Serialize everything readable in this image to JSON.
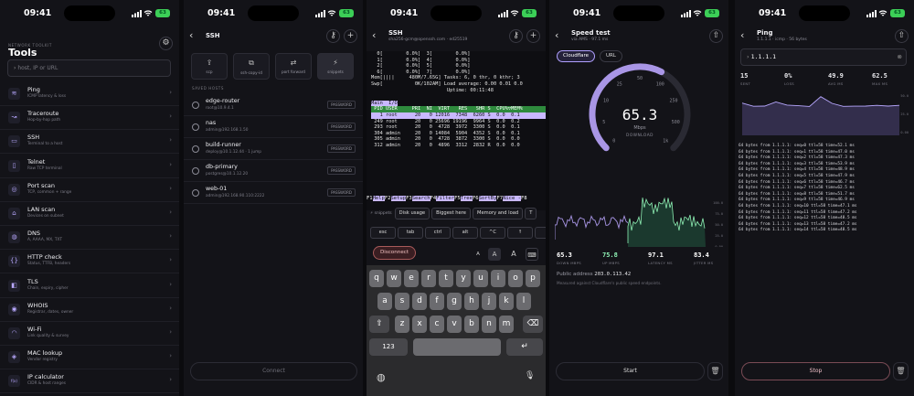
{
  "status": {
    "time": "09:41",
    "battery": "63"
  },
  "p1": {
    "kicker": "NETWORK TOOLKIT",
    "title": "Tools",
    "search_placeholder": "host, IP or URL",
    "tools": [
      {
        "name": "Ping",
        "desc": "ICMP latency & loss",
        "icon": "ping-icon",
        "glyph": "≋"
      },
      {
        "name": "Traceroute",
        "desc": "Hop-by-hop path",
        "icon": "route-icon",
        "glyph": "↝"
      },
      {
        "name": "SSH",
        "desc": "Terminal to a host",
        "icon": "terminal-icon",
        "glyph": "▭"
      },
      {
        "name": "Telnet",
        "desc": "Raw TCP terminal",
        "icon": "telnet-icon",
        "glyph": "▯"
      },
      {
        "name": "Port scan",
        "desc": "TCP, common + range",
        "icon": "port-icon",
        "glyph": "◎"
      },
      {
        "name": "LAN scan",
        "desc": "Devices on subnet",
        "icon": "lan-icon",
        "glyph": "⌂"
      },
      {
        "name": "DNS",
        "desc": "A, AAAA, MX, TXT",
        "icon": "globe-icon",
        "glyph": "◍"
      },
      {
        "name": "HTTP check",
        "desc": "Status, TTFB, headers",
        "icon": "braces-icon",
        "glyph": "{}"
      },
      {
        "name": "TLS",
        "desc": "Chain, expiry, cipher",
        "icon": "lock-icon",
        "glyph": "◧"
      },
      {
        "name": "WHOIS",
        "desc": "Registrar, dates, owner",
        "icon": "whois-icon",
        "glyph": "◉"
      },
      {
        "name": "Wi-Fi",
        "desc": "Link quality & survey",
        "icon": "wifi-icon",
        "glyph": "◠"
      },
      {
        "name": "MAC lookup",
        "desc": "Vendor registry",
        "icon": "mac-icon",
        "glyph": "◈"
      },
      {
        "name": "IP calculator",
        "desc": "CIDR & host ranges",
        "icon": "calc-icon",
        "glyph": "f(x)"
      }
    ]
  },
  "p2": {
    "title": "SSH",
    "segments": [
      "scp",
      "ssh-copy-id",
      "port forward",
      "snippets"
    ],
    "section": "SAVED HOSTS",
    "hosts": [
      {
        "name": "edge-router",
        "detail": "root@10.9.4.1",
        "badge": "PASSWORD"
      },
      {
        "name": "nas",
        "detail": "admin@192.168.1.50",
        "badge": "PASSWORD"
      },
      {
        "name": "build-runner",
        "detail": "deploy@10.1.12.44 · 1 jump",
        "badge": "PASSWORD"
      },
      {
        "name": "db-primary",
        "detail": "postgres@10.1.12.20",
        "badge": "PASSWORD"
      },
      {
        "name": "web-01",
        "detail": "admin@192.168.90.110:2222",
        "badge": "PASSWORD"
      }
    ],
    "connect": "Connect"
  },
  "p3": {
    "title": "SSH",
    "sub": "sha256-gcm@openssh.com · ed25519",
    "term": [
      "  0[        0.0%]  3[        0.0%]",
      "  1[        0.0%]  4[        0.0%]",
      "  2[        0.0%]  5[        0.0%]",
      "  6[        0.0%]  7[        0.0%]",
      "Mem[||||     480M/7.65G] Tasks: 6, 0 thr, 0 kthr; 3",
      "Swp[           0K/102AM] Load average: 0.00 0.01 0.0",
      "                          Uptime: 00:11:48"
    ],
    "tabs": "Main  I/O",
    "header": " PID USER     PRI  NI  VIRT   RES   SHR S  CPU%▽MEM%",
    "procs": [
      "   1 root      20   0 12016  7348  6260 S  0.0  0.1",
      " 249 root      20   0 25696 19196  9964 S  0.0  0.2",
      " 293 root      20   0  4728  3972  3300 S  0.0  0.1",
      " 304 admin     20   0 14084  5904  4352 S  0.0  0.1",
      " 305 admin     20   0  4728  3872  3300 S  0.0  0.0",
      " 312 admin     20   0  4896  3312  2832 R  0.0  0.0"
    ],
    "fkeys": [
      [
        "F1",
        "Help"
      ],
      [
        "F2",
        "Setup"
      ],
      [
        "F3",
        "Search"
      ],
      [
        "F4",
        "Filter"
      ],
      [
        "F5",
        "Tree"
      ],
      [
        "F6",
        "SortBy"
      ],
      [
        "F7",
        "Nice -"
      ],
      [
        "F8",
        ""
      ]
    ],
    "snippet_label": "snippets",
    "snippets": [
      "Disk usage",
      "Biggest here",
      "Memory and load",
      "T"
    ],
    "keys": [
      "esc",
      "tab",
      "ctrl",
      "alt",
      "^C",
      "↑",
      "↓"
    ],
    "disconnect": "Disconnect",
    "font_sizes": [
      "A",
      "A",
      "A"
    ],
    "kb_row1": [
      "q",
      "w",
      "e",
      "r",
      "t",
      "y",
      "u",
      "i",
      "o",
      "p"
    ],
    "kb_row2": [
      "a",
      "s",
      "d",
      "f",
      "g",
      "h",
      "j",
      "k",
      "l"
    ],
    "kb_row3": [
      "z",
      "x",
      "c",
      "v",
      "b",
      "n",
      "m"
    ],
    "kb_num": "123"
  },
  "p4": {
    "title": "Speed test",
    "sub": "via AMS · 97.1 ms",
    "tabs": [
      "Cloudflare",
      "URL"
    ],
    "gauge": {
      "value": 65.3,
      "unit": "Mbps",
      "mode": "DOWNLOAD",
      "ticks": [
        "0",
        "5",
        "10",
        "25",
        "50",
        "100",
        "250",
        "500",
        "1k"
      ],
      "fraction": 0.6
    },
    "axis": [
      "100.0",
      "75.0",
      "50.0",
      "25.0",
      "0.00"
    ],
    "stats": [
      {
        "v": "65.3",
        "l": "DOWN MBPS",
        "c": "#ffffff"
      },
      {
        "v": "75.8",
        "l": "UP MBPS",
        "c": "#8ef0b4"
      },
      {
        "v": "97.1",
        "l": "LATENCY MS",
        "c": "#ffffff"
      },
      {
        "v": "83.4",
        "l": "JITTER MS",
        "c": "#ffffff"
      }
    ],
    "public_label": "Public address",
    "public_ip": "203.0.113.42",
    "note": "Measured against Cloudflare's public speed endpoints.",
    "start": "Start"
  },
  "p5": {
    "title": "Ping",
    "sub": "1.1.1.1 · icmp · 56 bytes",
    "host": "1.1.1.1",
    "stats": [
      {
        "v": "15",
        "l": "SENT"
      },
      {
        "v": "0%",
        "l": "LOSS"
      },
      {
        "v": "49.9",
        "l": "AVG MS"
      },
      {
        "v": "62.5",
        "l": "MAX MS"
      }
    ],
    "axis": [
      "50.0",
      "25.0",
      "0.00"
    ],
    "lines": [
      "64 bytes from 1.1.1.1: seq=0 ttl=58 time=52.1 ms",
      "64 bytes from 1.1.1.1: seq=1 ttl=58 time=47.0 ms",
      "64 bytes from 1.1.1.1: seq=2 ttl=58 time=47.3 ms",
      "64 bytes from 1.1.1.1: seq=3 ttl=58 time=53.9 ms",
      "64 bytes from 1.1.1.1: seq=4 ttl=58 time=48.9 ms",
      "64 bytes from 1.1.1.1: seq=5 ttl=58 time=47.9 ms",
      "64 bytes from 1.1.1.1: seq=6 ttl=58 time=46.7 ms",
      "64 bytes from 1.1.1.1: seq=7 ttl=58 time=62.5 ms",
      "64 bytes from 1.1.1.1: seq=8 ttl=58 time=51.7 ms",
      "64 bytes from 1.1.1.1: seq=9 ttl=58 time=46.9 ms",
      "64 bytes from 1.1.1.1: seq=10 ttl=58 time=47.1 ms",
      "64 bytes from 1.1.1.1: seq=11 ttl=58 time=47.2 ms",
      "64 bytes from 1.1.1.1: seq=12 ttl=58 time=48.5 ms",
      "64 bytes from 1.1.1.1: seq=13 ttl=58 time=47.2 ms",
      "64 bytes from 1.1.1.1: seq=14 ttl=58 time=48.5 ms"
    ],
    "stop": "Stop"
  }
}
